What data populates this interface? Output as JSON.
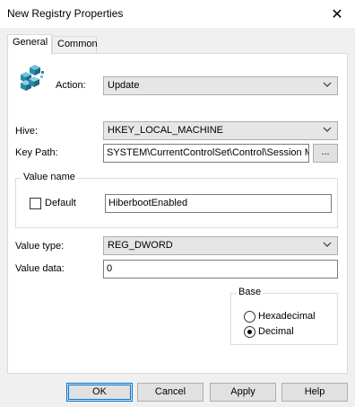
{
  "window": {
    "title": "New Registry Properties",
    "close_glyph": "✕"
  },
  "tabs": [
    {
      "label": "General",
      "active": true
    },
    {
      "label": "Common",
      "active": false
    }
  ],
  "general": {
    "icon": "registry-cubes-icon",
    "action_label": "Action:",
    "action_value": "Update",
    "hive_label": "Hive:",
    "hive_value": "HKEY_LOCAL_MACHINE",
    "keypath_label": "Key Path:",
    "keypath_value": "SYSTEM\\CurrentControlSet\\Control\\Session Ma",
    "browse_label": "...",
    "value_name_group": "Value name",
    "default_label": "Default",
    "default_checked": false,
    "value_name": "HiberbootEnabled",
    "value_type_label": "Value type:",
    "value_type": "REG_DWORD",
    "value_data_label": "Value data:",
    "value_data": "0",
    "base_group": "Base",
    "base_options": [
      {
        "label": "Hexadecimal",
        "selected": false
      },
      {
        "label": "Decimal",
        "selected": true
      }
    ]
  },
  "buttons": {
    "ok": "OK",
    "cancel": "Cancel",
    "apply": "Apply",
    "help": "Help"
  },
  "colors": {
    "accent": "#0078d7",
    "window_bg": "#f0f0f0",
    "panel_bg": "#ffffff"
  }
}
